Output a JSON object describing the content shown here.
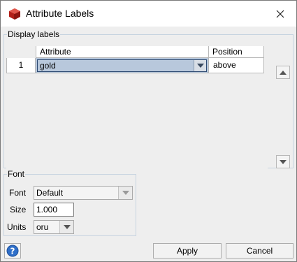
{
  "window": {
    "title": "Attribute Labels",
    "icons": {
      "app": "ruby-cube-icon",
      "close": "close-icon"
    }
  },
  "display_labels": {
    "legend": "Display labels",
    "columns": [
      "Attribute",
      "Position"
    ],
    "rows": [
      {
        "index": "1",
        "attribute": "gold",
        "position": "above"
      }
    ]
  },
  "font": {
    "legend": "Font",
    "font_label": "Font",
    "font_value": "Default",
    "size_label": "Size",
    "size_value": "1.000",
    "units_label": "Units",
    "units_value": "oru"
  },
  "buttons": {
    "apply": "Apply",
    "cancel": "Cancel",
    "help_icon": "help-icon"
  },
  "colors": {
    "selected_cell": "#b8c8dc",
    "fieldset_border": "#c6d3e0",
    "icon_red": "#c0241c"
  }
}
